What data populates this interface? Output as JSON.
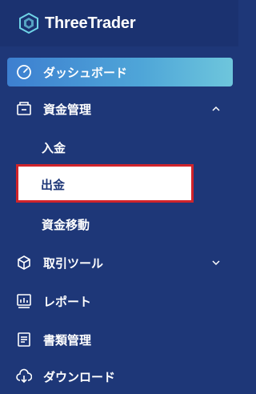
{
  "brand": {
    "name": "ThreeTrader"
  },
  "nav": {
    "dashboard": "ダッシュボード",
    "funds": "資金管理",
    "funds_sub": [
      "入金",
      "出金",
      "資金移動"
    ],
    "trading_tools": "取引ツール",
    "reports": "レポート",
    "documents": "書類管理",
    "downloads": "ダウンロード"
  },
  "colors": {
    "bg": "#1e3778",
    "active": "#4fa6d8",
    "highlight": "#d0242b"
  }
}
